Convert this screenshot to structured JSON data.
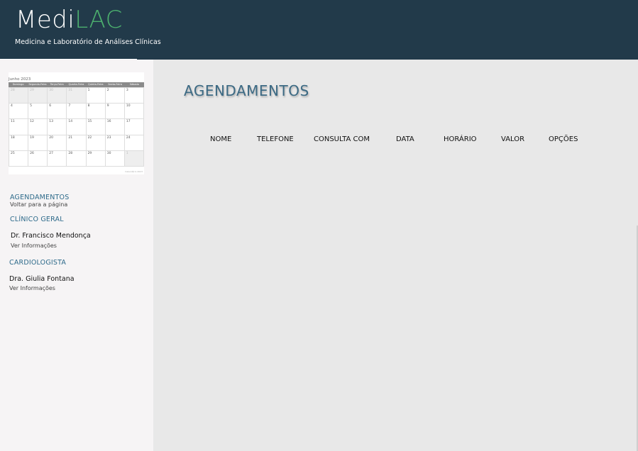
{
  "header": {
    "logo_medi": "Medi",
    "logo_lac": "LAC",
    "subtitle": "Medicina e Laboratório de Análises Clínicas"
  },
  "calendar": {
    "title": "Junho 2023",
    "weekdays": [
      "Domingo",
      "Segunda-Feira",
      "Terça-Feira",
      "Quarta-Feira",
      "Quinta-Feira",
      "Sexta-Feira",
      "Sábado"
    ],
    "days": [
      "28",
      "29",
      "30",
      "31",
      "1",
      "2",
      "3",
      "4",
      "5",
      "6",
      "7",
      "8",
      "9",
      "10",
      "11",
      "12",
      "13",
      "14",
      "15",
      "16",
      "17",
      "18",
      "19",
      "20",
      "21",
      "22",
      "23",
      "24",
      "25",
      "26",
      "27",
      "28",
      "29",
      "30",
      "1"
    ],
    "footer": "Calendário 2023"
  },
  "sidebar": {
    "agendamentos_heading": "AGENDAMENTOS",
    "back_link": "Voltar para a página",
    "clinico_heading": "CLÍNICO GERAL",
    "doctor1_name": "Dr. Francisco Mendonça",
    "doctor1_link": "Ver Informações",
    "cardio_heading": "CARDIOLOGISTA",
    "doctor2_name": "Dra. Giulia Fontana",
    "doctor2_link": "Ver Informações"
  },
  "main": {
    "title": "AGENDAMENTOS",
    "columns": [
      "NOME",
      "TELEFONE",
      "CONSULTA COM",
      "DATA",
      "HORÁRIO",
      "VALOR",
      "OPÇÕES"
    ]
  },
  "colors": {
    "header_bg": "#223a4a",
    "logo_accent": "#4caf6e",
    "heading_blue": "#2d6a8a",
    "sidebar_bg": "#f6f4f5",
    "main_bg": "#e8e8e8"
  }
}
